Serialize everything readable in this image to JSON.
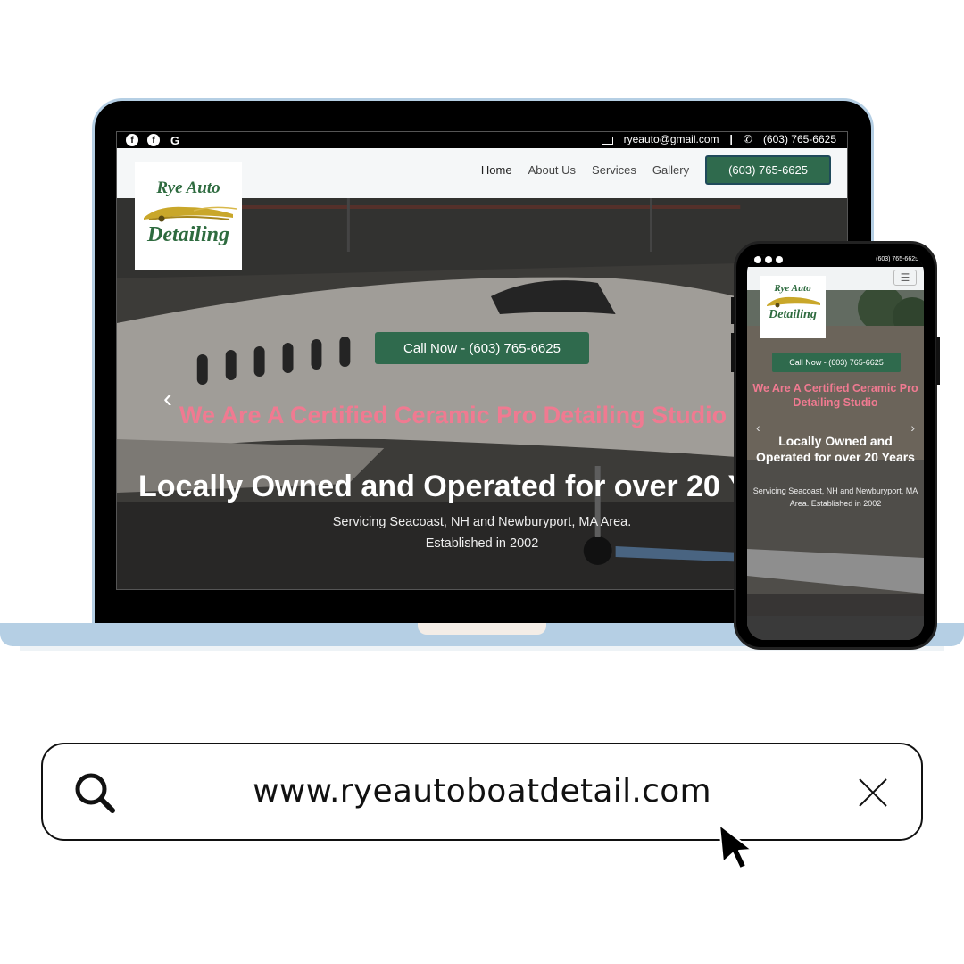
{
  "colors": {
    "brand_green": "#2f6a4d",
    "heading_pink": "#f07a91",
    "laptop_frame": "#b5cfe4",
    "logo_green": "#2e6b3f"
  },
  "desktop": {
    "topbar": {
      "social_icons": [
        "facebook-icon",
        "facebook-icon",
        "google-icon"
      ],
      "email": "ryeauto@gmail.com",
      "separator": "|",
      "phone": "(603) 765-6625"
    },
    "logo": {
      "line1": "Rye Auto",
      "line2": "Detailing"
    },
    "nav": {
      "links": [
        "Home",
        "About Us",
        "Services",
        "Gallery"
      ],
      "cta": "(603) 765-6625"
    },
    "hero": {
      "button": "Call Now - (603) 765-6625",
      "heading": "We Are A Certified Ceramic Pro Detailing Studio",
      "title": "Locally Owned and Operated for over 20 Years",
      "sub_line1": "Servicing Seacoast, NH and Newburyport, MA Area.",
      "sub_line2": "Established in 2002",
      "prev_icon": "chevron-left-icon"
    }
  },
  "mobile": {
    "topbar_phone": "(603) 765-6625",
    "logo": {
      "line1": "Rye Auto",
      "line2": "Detailing"
    },
    "menu_icon": "hamburger-icon",
    "hero": {
      "button": "Call Now - (603) 765-6625",
      "heading": "We Are A Certified Ceramic Pro Detailing Studio",
      "title": "Locally Owned and Operated for over 20 Years",
      "sub": "Servicing Seacoast, NH and Newburyport, MA Area. Established in 2002"
    }
  },
  "search": {
    "url": "www.ryeautoboatdetail.com",
    "search_icon": "search-icon",
    "close_icon": "close-icon",
    "cursor_icon": "cursor-arrow-icon"
  }
}
